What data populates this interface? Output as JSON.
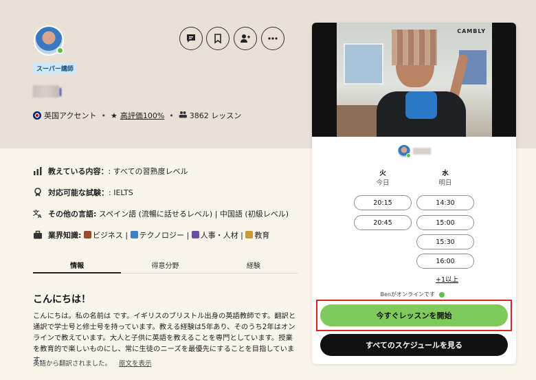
{
  "profile": {
    "badge": "スーパー講師",
    "accent": "英国アクセント",
    "rating_label": "高評価100%",
    "lessons": "3862 レッスン",
    "icons": [
      "message-icon",
      "bookmark-icon",
      "add-person-icon",
      "more-icon"
    ]
  },
  "info": {
    "teaches_label": "教えている内容：",
    "teaches_value": ": すべての習熟度レベル",
    "exam_label": "対応可能な試験：",
    "exam_value": ": IELTS",
    "languages_label": "その他の言語:",
    "languages_value": " スペイン語 (流暢に話せるレベル) | 中国語 (初級レベル)",
    "industry_label": "業界知識:",
    "industry_items": [
      "ビジネス",
      "テクノロジー",
      "人事・人材",
      "教育"
    ]
  },
  "tabs": [
    "情報",
    "得意分野",
    "経験"
  ],
  "about": {
    "greeting": "こんにちは！",
    "bio": "こんにちは。私の名前は   です。イギリスのブリストル出身の英語教師です。翻訳と通訳で学士号と修士号を持っています。教える経験は5年あり、そのうち2年はオンラインで教えています。大人と子供に英語を教えることを専門としています。授業を教育的で楽しいものにし、常に生徒のニーズを最優先にすることを目指しています。",
    "translated_note": "英語から翻訳されました。",
    "show_original": "原文を表示"
  },
  "booking": {
    "video_watermark": "CAMBLY",
    "days": [
      {
        "name": "火",
        "sub": "今日",
        "slots": [
          "20:15",
          "20:45"
        ]
      },
      {
        "name": "水",
        "sub": "明日",
        "slots": [
          "14:30",
          "15:00",
          "15:30",
          "16:00"
        ]
      }
    ],
    "more_link": "+1以上",
    "online_text": "Benがオンラインです",
    "start_button": "今すぐレッスンを開始",
    "schedule_button": "すべてのスケジュールを見る",
    "highlight_color": "#e0202a",
    "start_color": "#7ecb5c"
  }
}
